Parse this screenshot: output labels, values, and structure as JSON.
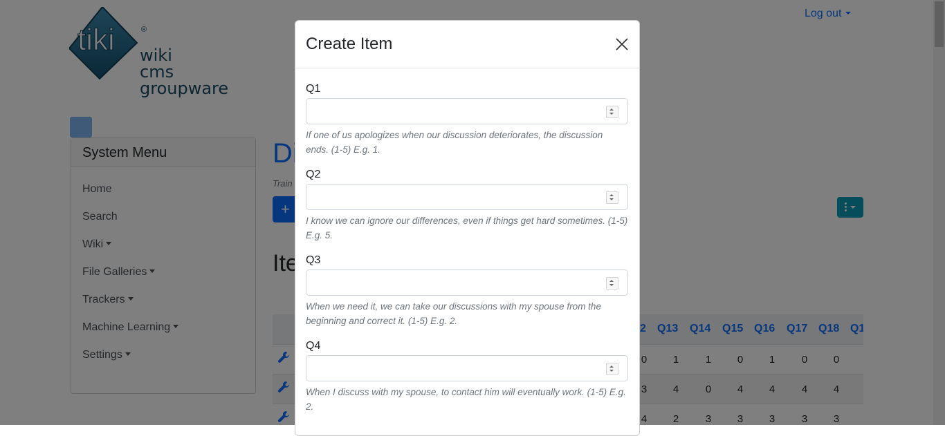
{
  "header": {
    "logo_main": "tiki",
    "logo_registered": "®",
    "logo_sub": [
      "wiki",
      "cms",
      "groupware"
    ],
    "logout_label": "Log out"
  },
  "system_menu": {
    "title": "System Menu",
    "items": [
      {
        "label": "Home",
        "has_dropdown": false
      },
      {
        "label": "Search",
        "has_dropdown": false
      },
      {
        "label": "Wiki",
        "has_dropdown": true
      },
      {
        "label": "File Galleries",
        "has_dropdown": true
      },
      {
        "label": "Trackers",
        "has_dropdown": true
      },
      {
        "label": "Machine Learning",
        "has_dropdown": true
      },
      {
        "label": "Settings",
        "has_dropdown": true
      }
    ]
  },
  "main": {
    "page_title": "Di",
    "breadcrumb": "Train",
    "add_button": "+",
    "section_title": "Ite",
    "table": {
      "headers": [
        "2",
        "Q13",
        "Q14",
        "Q15",
        "Q16",
        "Q17",
        "Q18",
        "Q1"
      ],
      "rows": [
        [
          "0",
          "1",
          "1",
          "0",
          "1",
          "0",
          "0"
        ],
        [
          "3",
          "4",
          "0",
          "4",
          "4",
          "4",
          "4"
        ],
        [
          "4",
          "2",
          "3",
          "3",
          "3",
          "3",
          "3"
        ]
      ]
    }
  },
  "modal": {
    "title": "Create Item",
    "close_label": "Close",
    "fields": [
      {
        "label": "Q1",
        "value": "",
        "help": "If one of us apologizes when our discussion deteriorates, the discussion ends. (1-5) E.g. 1."
      },
      {
        "label": "Q2",
        "value": "",
        "help": "I know we can ignore our differences, even if things get hard sometimes. (1-5) E.g. 5."
      },
      {
        "label": "Q3",
        "value": "",
        "help": "When we need it, we can take our discussions with my spouse from the beginning and correct it. (1-5) E.g. 2."
      },
      {
        "label": "Q4",
        "value": "",
        "help": "When I discuss with my spouse, to contact him will eventually work. (1-5) E.g. 2."
      }
    ]
  },
  "colors": {
    "primary": "#0d6efd",
    "logo_teal": "#1b5e7e",
    "info": "#0d9bb8",
    "backdrop": "rgba(0,0,0,0.5)"
  }
}
